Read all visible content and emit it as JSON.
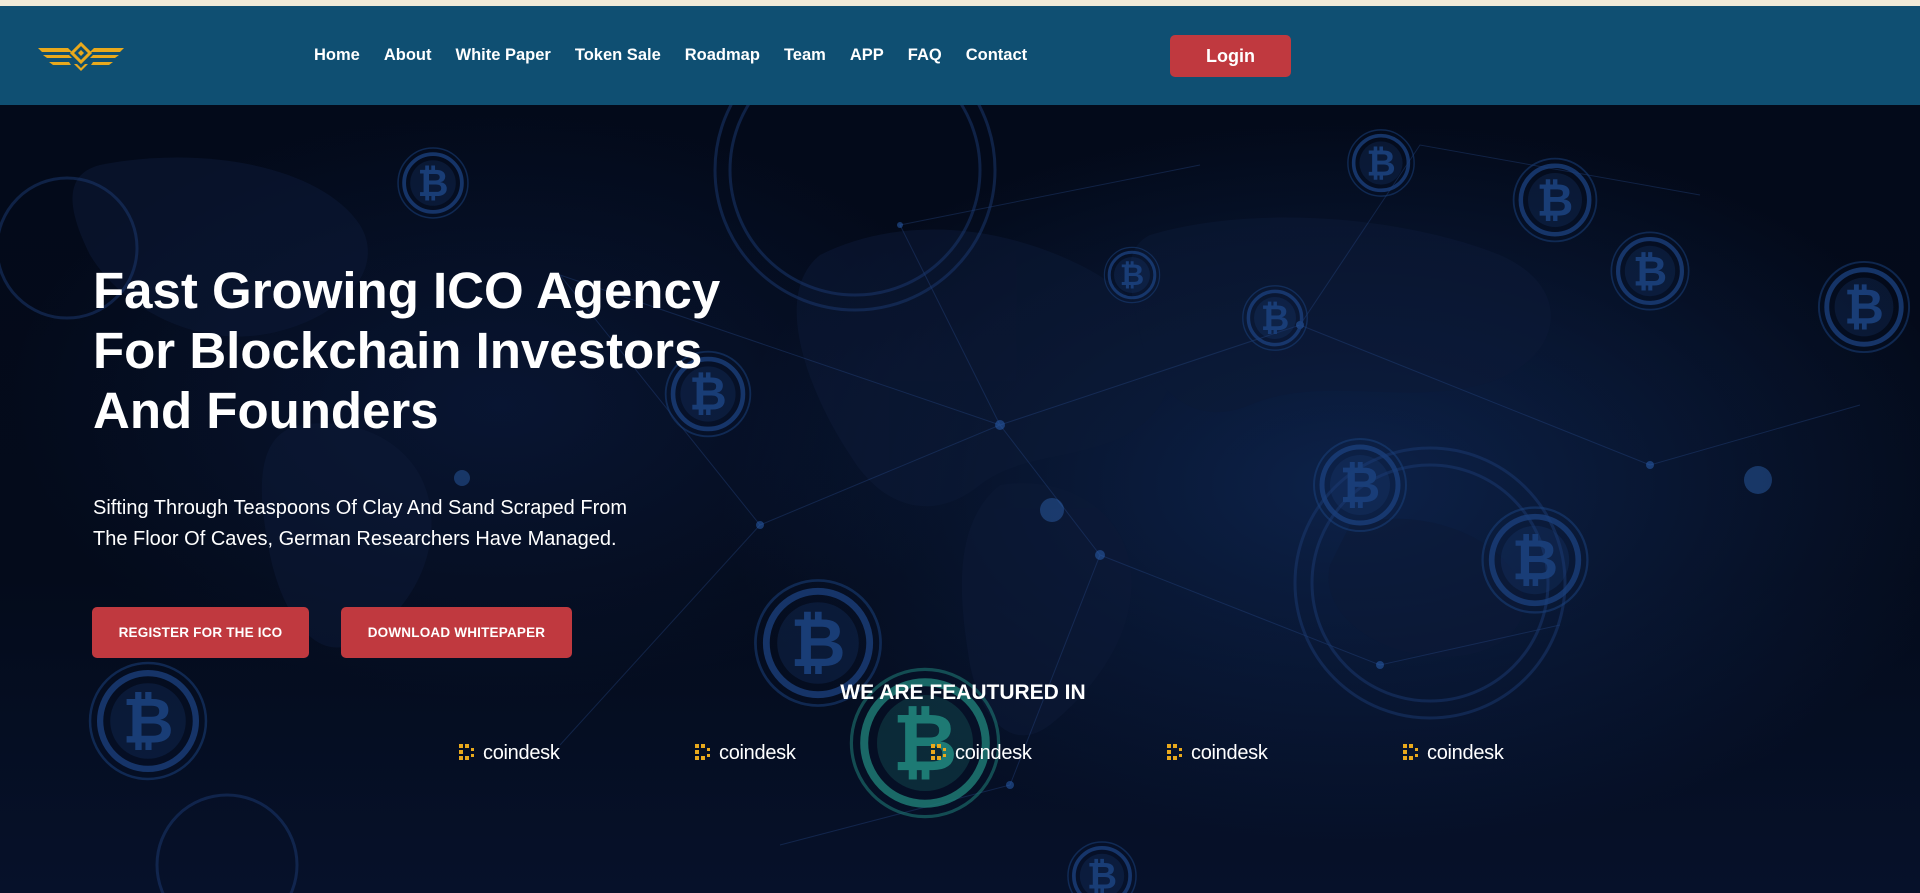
{
  "nav": {
    "items": [
      {
        "label": "Home"
      },
      {
        "label": "About"
      },
      {
        "label": "White Paper"
      },
      {
        "label": "Token Sale"
      },
      {
        "label": "Roadmap"
      },
      {
        "label": "Team"
      },
      {
        "label": "APP"
      },
      {
        "label": "FAQ"
      },
      {
        "label": "Contact"
      }
    ],
    "login_label": "Login"
  },
  "hero": {
    "title": "Fast Growing ICO Agency For Blockchain Investors And Founders",
    "subtitle": "Sifting Through Teaspoons Of Clay And Sand Scraped From The Floor Of Caves, German Researchers Have Managed.",
    "register_label": "REGISTER FOR THE ICO",
    "download_label": "DOWNLOAD WHITEPAPER"
  },
  "featured": {
    "heading": "WE ARE FEAUTURED IN",
    "logos": [
      "coindesk",
      "coindesk",
      "coindesk",
      "coindesk",
      "coindesk"
    ]
  },
  "icons": {
    "logo": "winged-diamond-logo",
    "background_coin": "bitcoin-icon",
    "partner": "coindesk-logo-icon"
  },
  "colors": {
    "nav_bg": "#0f4f72",
    "accent_red": "#c0393f",
    "hero_bg": "#030814",
    "logo_gold": "#e9a91c",
    "coin_blue": "#1a3f7a",
    "coin_teal": "#1f7f78"
  }
}
